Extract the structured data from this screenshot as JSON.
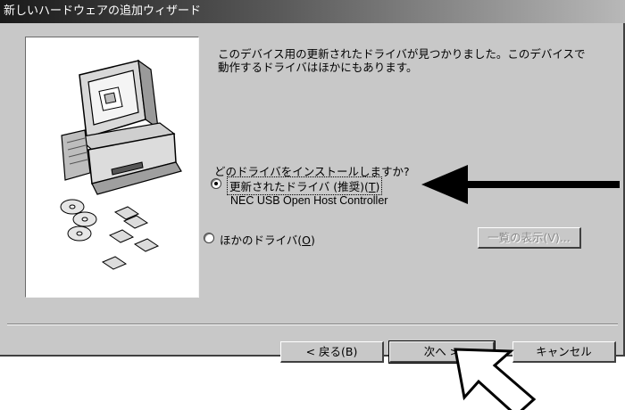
{
  "window": {
    "title": "新しいハードウェアの追加ウィザード"
  },
  "content": {
    "message_line1": "このデバイス用の更新されたドライバが見つかりました。このデバイスで",
    "message_line2": "動作するドライバはほかにもあります。",
    "question": "どのドライバをインストールしますか?"
  },
  "options": [
    {
      "label_text": "更新されたドライバ (推奨)(",
      "label_key": "T",
      "label_end": ")",
      "selected": true,
      "detail": "NEC USB Open Host Controller"
    },
    {
      "label_text": "ほかのドライバ(",
      "label_key": "O",
      "label_end": ")",
      "selected": false
    }
  ],
  "buttons": {
    "show_list": "一覧の表示(V)...",
    "back": "< 戻る(B)",
    "next": "次へ >",
    "cancel": "キャンセル"
  },
  "colors": {
    "dialog_face": "#c8c8c8",
    "titlebar_start": "#1a1a1a",
    "titlebar_end": "#b8b8b8",
    "annotation_arrow": "#000000"
  },
  "icons": [
    "computer-icon",
    "cd-icon",
    "floppy-disk-icon",
    "pointer-arrow-icon",
    "mouse-cursor-icon"
  ]
}
